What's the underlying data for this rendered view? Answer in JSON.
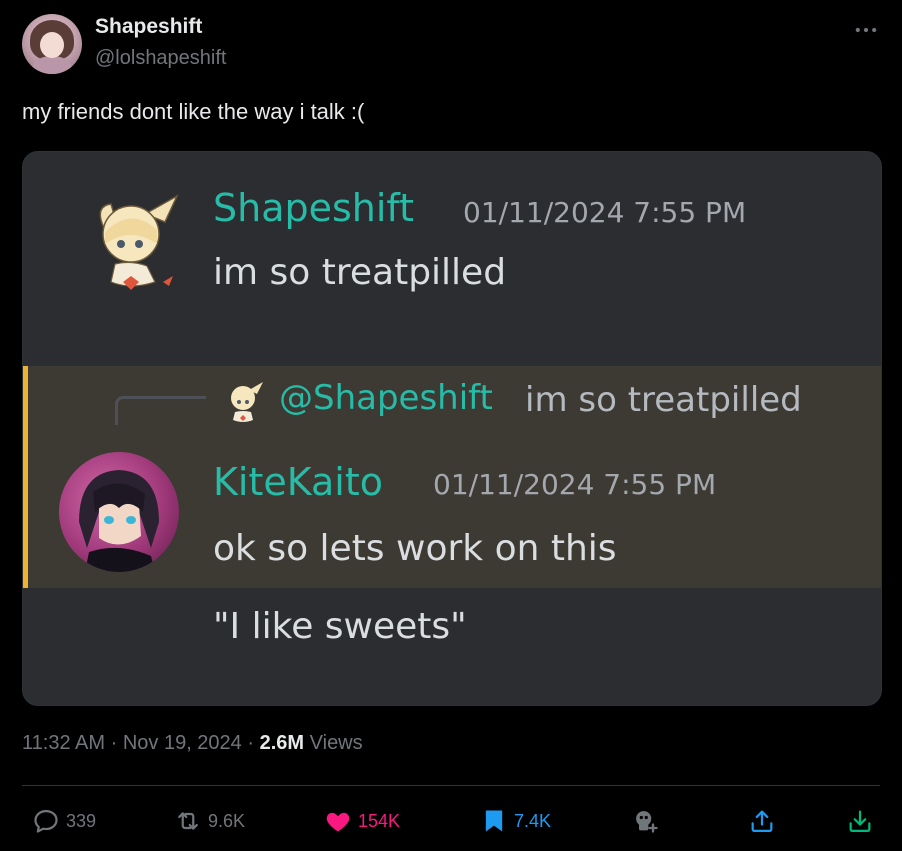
{
  "author": {
    "name": "Shapeshift",
    "handle": "@lolshapeshift"
  },
  "tweet": {
    "text": "my friends dont like the way i talk :("
  },
  "embed": {
    "message1": {
      "username": "Shapeshift",
      "timestamp": "01/11/2024 7:55 PM",
      "text": "im so treatpilled"
    },
    "reply_preview": {
      "mention": "@Shapeshift",
      "snippet": "im so treatpilled"
    },
    "message2": {
      "username": "KiteKaito",
      "timestamp": "01/11/2024 7:55 PM",
      "line1": "ok so lets work on this",
      "line2": "\"I like sweets\""
    }
  },
  "meta": {
    "time": "11:32 AM",
    "date": "Nov 19, 2024",
    "views_count": "2.6M",
    "views_label": "Views",
    "sep": "·"
  },
  "actions": {
    "replies": "339",
    "reposts": "9.6K",
    "likes": "154K",
    "bookmarks": "7.4K"
  },
  "colors": {
    "like": "#f91880",
    "bookmark": "#1d9bf0",
    "muted": "#71767b",
    "teal_name": "#27bca8",
    "mention_bar": "#f0b232"
  },
  "icons": [
    "more-icon",
    "reply-icon",
    "repost-icon",
    "like-icon",
    "bookmark-icon",
    "grok-icon",
    "share-icon",
    "download-icon"
  ]
}
